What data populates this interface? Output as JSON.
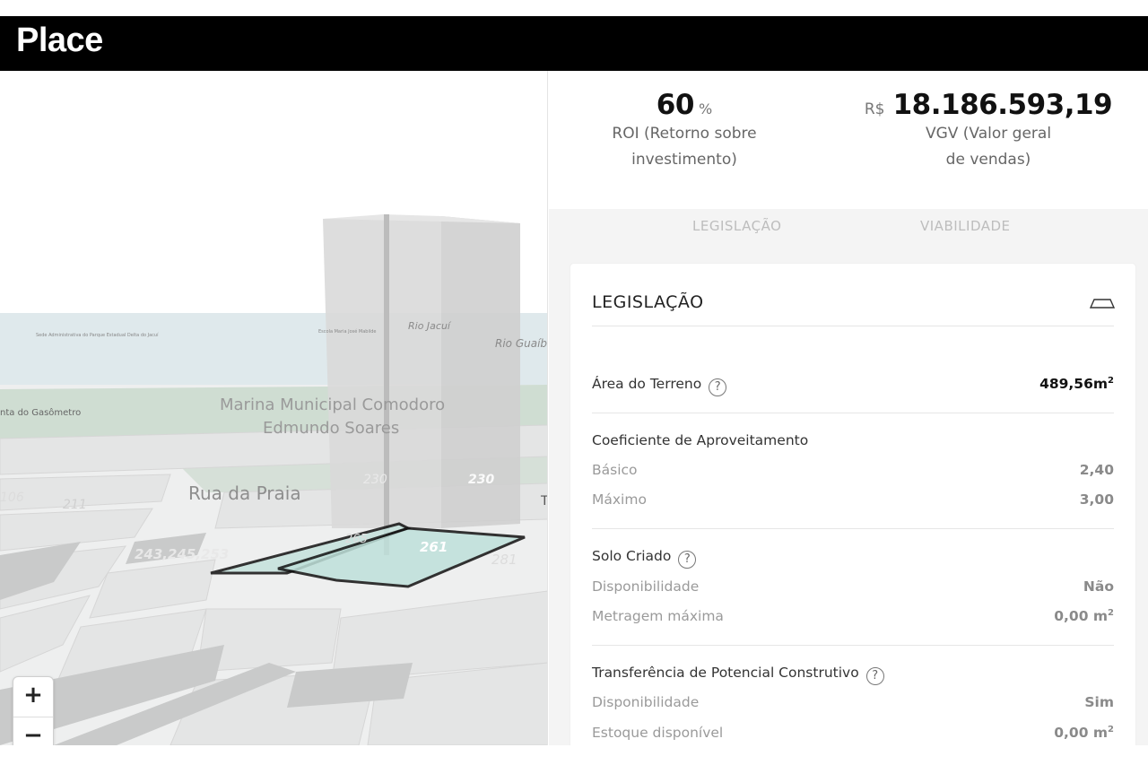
{
  "app": {
    "brand": "Place"
  },
  "map": {
    "labels": {
      "rio_jacui": "Rio Jacuí",
      "rio_guaiba": "Rio Guaíb",
      "escola": "Escola Maria José Mabilde",
      "sede": "Sede Administrativa do Parque Estadual Delta do Jacuí",
      "gasometro": "nta do Gasômetro",
      "marina_l1": "Marina Municipal Comodoro",
      "marina_l2": "Edmundo Soares",
      "rua": "Rua da Praia",
      "n230a": "230",
      "n230b": "230",
      "n211": "211",
      "n106": "106",
      "n243": "243,245,253",
      "n261": "261",
      "n265": "265",
      "n281": "281",
      "t": "T"
    },
    "zoom": {
      "in": "+",
      "out": "−"
    }
  },
  "kpis": {
    "roi": {
      "value": "60",
      "unit": "%",
      "label_l1": "ROI (Retorno sobre",
      "label_l2": "investimento)"
    },
    "vgv": {
      "prefix": "R$",
      "value": "18.186.593,19",
      "label_l1": "VGV (Valor geral",
      "label_l2": "de vendas)"
    }
  },
  "tabs": {
    "legislacao": "LEGISLAÇÃO",
    "viabilidade": "VIABILIDADE"
  },
  "card": {
    "title": "LEGISLAÇÃO",
    "area": {
      "label": "Área do Terreno",
      "value": "489,56m",
      "sup": "2"
    },
    "coef": {
      "label": "Coeficiente de Aproveitamento",
      "basico_label": "Básico",
      "basico_value": "2,40",
      "maximo_label": "Máximo",
      "maximo_value": "3,00"
    },
    "solo": {
      "label": "Solo Criado",
      "disp_label": "Disponibilidade",
      "disp_value": "Não",
      "met_label": "Metragem máxima",
      "met_value": "0,00 m",
      "met_sup": "2"
    },
    "transf": {
      "label": "Transferência de Potencial Construtivo",
      "disp_label": "Disponibilidade",
      "disp_value": "Sim",
      "est_label": "Estoque disponível",
      "est_value": "0,00 m",
      "est_sup": "2"
    },
    "help_glyph": "?"
  },
  "colors": {
    "topbar": "#000000",
    "selection": "#111111",
    "selection_fill": "#b9dfd8",
    "water": "#dde8ec",
    "park": "#c8d9cc"
  },
  "icons": {
    "collapse": "collapse-tray-icon",
    "help": "help-circle-icon",
    "compass": "compass-icon"
  }
}
